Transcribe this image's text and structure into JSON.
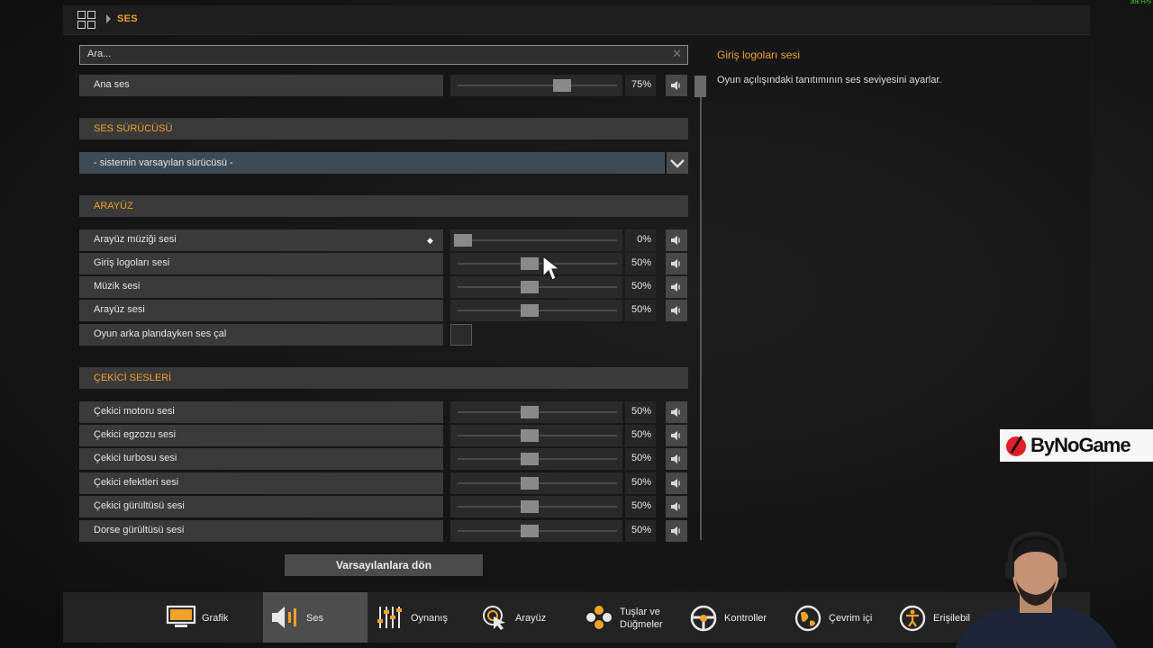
{
  "fps_text": "306 FPS",
  "breadcrumb": {
    "current": "SES"
  },
  "search": {
    "placeholder": "Ara..."
  },
  "master": {
    "label": "Ana ses",
    "value": "75%",
    "level": 0.75
  },
  "driver_section": {
    "title": "SES SÜRÜCÜSÜ",
    "selected": "- sistemin varsayılan sürücüsü -"
  },
  "ui_section": {
    "title": "ARAYÜZ",
    "rows": [
      {
        "label": "Arayüz müziği sesi",
        "value": "0%",
        "level": 0.0
      },
      {
        "label": "Giriş logoları sesi",
        "value": "50%",
        "level": 0.5
      },
      {
        "label": "Müzik sesi",
        "value": "50%",
        "level": 0.5
      },
      {
        "label": "Arayüz sesi",
        "value": "50%",
        "level": 0.5
      }
    ],
    "background_label": "Oyun arka plandayken ses çal",
    "background_checked": false
  },
  "truck_section": {
    "title": "ÇEKİCİ SESLERİ",
    "rows": [
      {
        "label": "Çekici motoru sesi",
        "value": "50%",
        "level": 0.5
      },
      {
        "label": "Çekici egzozu sesi",
        "value": "50%",
        "level": 0.5
      },
      {
        "label": "Çekici turbosu sesi",
        "value": "50%",
        "level": 0.5
      },
      {
        "label": "Çekici efektleri sesi",
        "value": "50%",
        "level": 0.5
      },
      {
        "label": "Çekici gürültüsü sesi",
        "value": "50%",
        "level": 0.5
      },
      {
        "label": "Dorse gürültüsü sesi",
        "value": "50%",
        "level": 0.5
      }
    ]
  },
  "reset_button": "Varsayılanlara dön",
  "description": {
    "title": "Giriş logoları sesi",
    "body": "Oyun açılışındaki tanıtımının ses seviyesini ayarlar."
  },
  "tabs": [
    {
      "label": "Grafik",
      "icon": "monitor-icon"
    },
    {
      "label": "Ses",
      "icon": "speaker-icon",
      "active": true
    },
    {
      "label": "Oynanış",
      "icon": "sliders-icon"
    },
    {
      "label": "Arayüz",
      "icon": "cursor-icon"
    },
    {
      "label_line1": "Tuşlar ve",
      "label_line2": "Düğmeler",
      "icon": "buttons-icon"
    },
    {
      "label": "Kontroller",
      "icon": "steering-wheel-icon"
    },
    {
      "label": "Çevrim içi",
      "icon": "globe-icon"
    },
    {
      "label": "Erişilebil",
      "icon": "accessibility-icon"
    }
  ],
  "logo": {
    "text": "ByNoGame"
  },
  "colors": {
    "accent": "#f0a22a",
    "row_bg": "#3a3a3a",
    "active_tab": "#4d4d4d"
  }
}
